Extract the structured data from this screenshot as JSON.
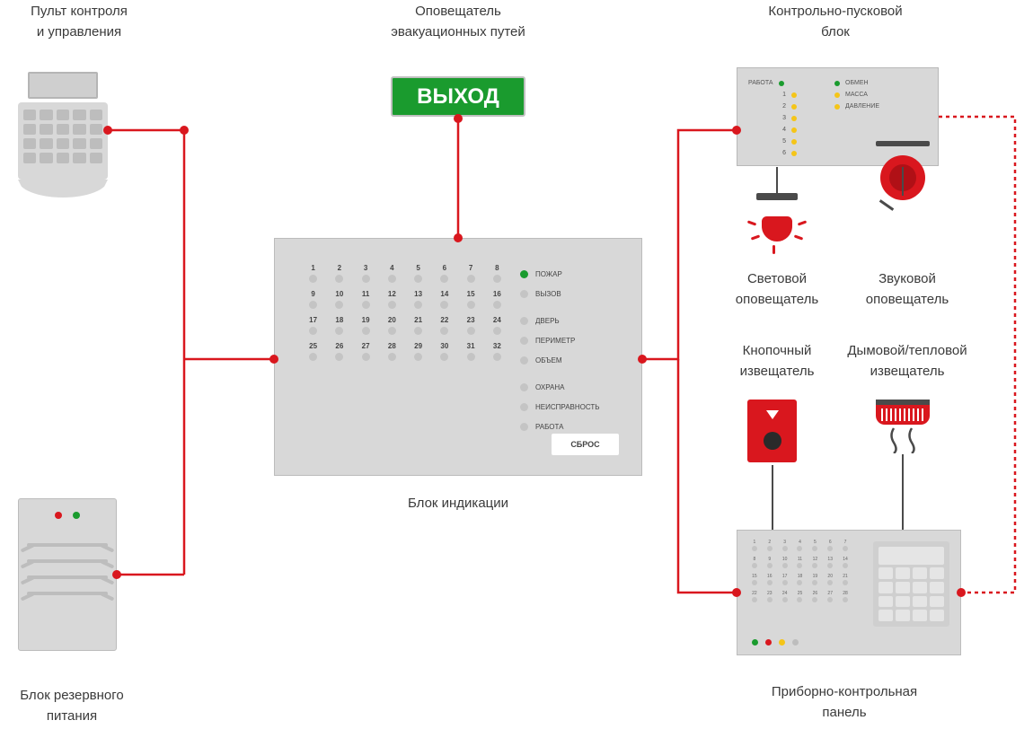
{
  "labels": {
    "keypad": "Пульт контроля\nи управления",
    "exit_sign_title": "Оповещатель\nэвакуационных путей",
    "exit_text": "ВЫХОД",
    "ctrl_block": "Контрольно-пусковой\nблок",
    "ind_block": "Блок индикации",
    "psu": "Блок резервного\nпитания",
    "light_notif": "Световой\nоповещатель",
    "sound_notif": "Звуковой\nоповещатель",
    "call_point": "Кнопочный\nизвещатель",
    "smoke_det": "Дымовой/тепловой\nизвещатель",
    "panel": "Приборно-контрольная\nпанель"
  },
  "ctrl_block": {
    "left_header": "РАБОТА",
    "rows": [
      "1",
      "2",
      "3",
      "4",
      "5",
      "6"
    ],
    "right": [
      "ОБМЕН",
      "МАССА",
      "ДАВЛЕНИЕ"
    ]
  },
  "indication": {
    "zones": [
      "1",
      "2",
      "3",
      "4",
      "5",
      "6",
      "7",
      "8",
      "9",
      "10",
      "11",
      "12",
      "13",
      "14",
      "15",
      "16",
      "17",
      "18",
      "19",
      "20",
      "21",
      "22",
      "23",
      "24",
      "25",
      "26",
      "27",
      "28",
      "29",
      "30",
      "31",
      "32"
    ],
    "status": [
      {
        "label": "ПОЖАР",
        "color": "green"
      },
      {
        "label": "ВЫЗОВ",
        "color": "gray"
      },
      {
        "label": "ДВЕРЬ",
        "color": "gray"
      },
      {
        "label": "ПЕРИМЕТР",
        "color": "gray"
      },
      {
        "label": "ОБЪЕМ",
        "color": "gray"
      },
      {
        "label": "ОХРАНА",
        "color": "gray"
      },
      {
        "label": "НЕИСПРАВНОСТЬ",
        "color": "gray"
      },
      {
        "label": "РАБОТА",
        "color": "gray"
      }
    ],
    "reset": "СБРОС"
  },
  "panel_zones": [
    "1",
    "2",
    "3",
    "4",
    "5",
    "6",
    "7",
    "8",
    "9",
    "10",
    "11",
    "12",
    "13",
    "14",
    "15",
    "16",
    "17",
    "18",
    "19",
    "20",
    "21",
    "22",
    "23",
    "24",
    "25",
    "26",
    "27",
    "28"
  ],
  "colors": {
    "red": "#d9171e",
    "green": "#1a9b2e",
    "yellow": "#f5c518",
    "gray_device": "#d8d8d8"
  }
}
